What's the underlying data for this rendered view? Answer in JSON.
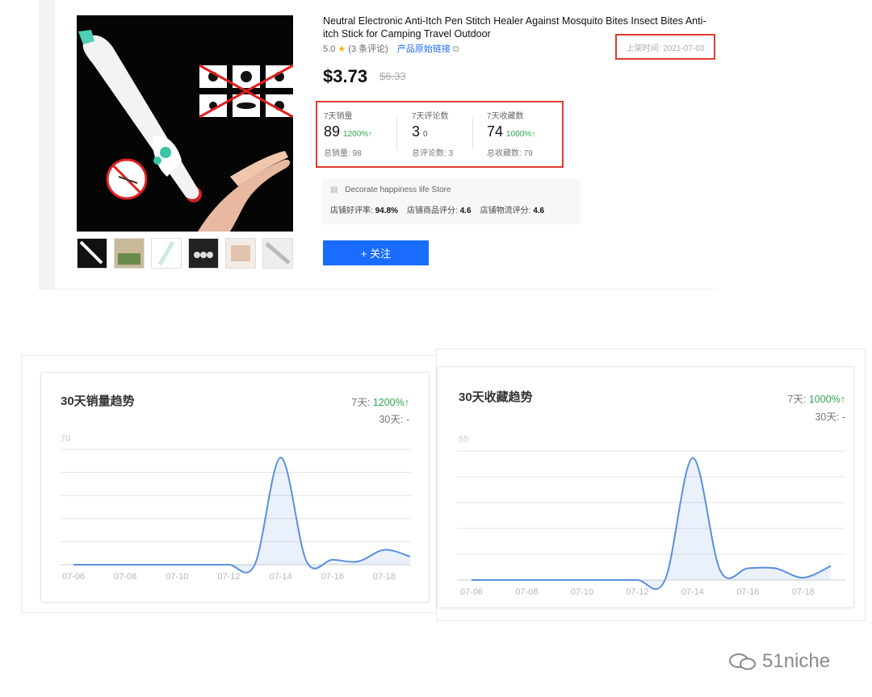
{
  "product": {
    "title": "Neutral Electronic Anti-Itch Pen Stitch Healer Against Mosquito Bites Insect Bites Anti-itch Stick for Camping Travel Outdoor",
    "rating": "5.0",
    "reviews": "(3 条评论)",
    "source_link": "产品原始链接",
    "listed_time": "上架时间: 2021-07-03",
    "price": "$3.73",
    "old_price": "$6.33",
    "thumbnails": [
      "thumb-1",
      "thumb-2",
      "thumb-3",
      "thumb-4",
      "thumb-5",
      "thumb-6"
    ]
  },
  "stats": [
    {
      "label": "7天销量",
      "value": "89",
      "change": "1200%↑",
      "total": "总销量: 98"
    },
    {
      "label": "7天评论数",
      "value": "3",
      "change": "0",
      "total": "总评论数: 3"
    },
    {
      "label": "7天收藏数",
      "value": "74",
      "change": "1000%↑",
      "total": "总收藏数: 79"
    }
  ],
  "store": {
    "name": "Decorate happiness life Store",
    "positive_label": "店铺好评率:",
    "positive_value": "94.8%",
    "goods_label": "店铺商品评分:",
    "goods_value": "4.6",
    "logistics_label": "店铺物流评分:",
    "logistics_value": "4.6"
  },
  "follow_button": "+ 关注",
  "watermark": "51niche",
  "colors": {
    "accent": "#1a6cff",
    "highlight": "#e03a2f",
    "up": "#2fa84f",
    "line": "#5b8fe0"
  },
  "chart_data": [
    {
      "type": "area",
      "title": "30天销量趋势",
      "stat_7d_label": "7天:",
      "stat_7d_value": "1200%↑",
      "stat_30d": "30天: -",
      "ytick_top": "70",
      "ylim": [
        0,
        70
      ],
      "xticks": [
        "07-06",
        "07-08",
        "07-10",
        "07-12",
        "07-14",
        "07-16",
        "07-18"
      ],
      "x": [
        "07-06",
        "07-07",
        "07-08",
        "07-09",
        "07-10",
        "07-11",
        "07-12",
        "07-13",
        "07-14",
        "07-15",
        "07-16",
        "07-17",
        "07-18",
        "07-19"
      ],
      "values": [
        0,
        0,
        0,
        0,
        0,
        0,
        0,
        0,
        65,
        2,
        3,
        2,
        9,
        5
      ]
    },
    {
      "type": "area",
      "title": "30天收藏趋势",
      "stat_7d_label": "7天:",
      "stat_7d_value": "1000%↑",
      "stat_30d": "30天: -",
      "ytick_top": "55",
      "ylim": [
        0,
        55
      ],
      "xticks": [
        "07-06",
        "07-08",
        "07-10",
        "07-12",
        "07-14",
        "07-16",
        "07-18"
      ],
      "x": [
        "07-06",
        "07-07",
        "07-08",
        "07-09",
        "07-10",
        "07-11",
        "07-12",
        "07-13",
        "07-14",
        "07-15",
        "07-16",
        "07-17",
        "07-18",
        "07-19"
      ],
      "values": [
        0,
        0,
        0,
        0,
        0,
        0,
        0,
        0,
        52,
        4,
        5,
        5,
        1,
        6
      ]
    }
  ]
}
